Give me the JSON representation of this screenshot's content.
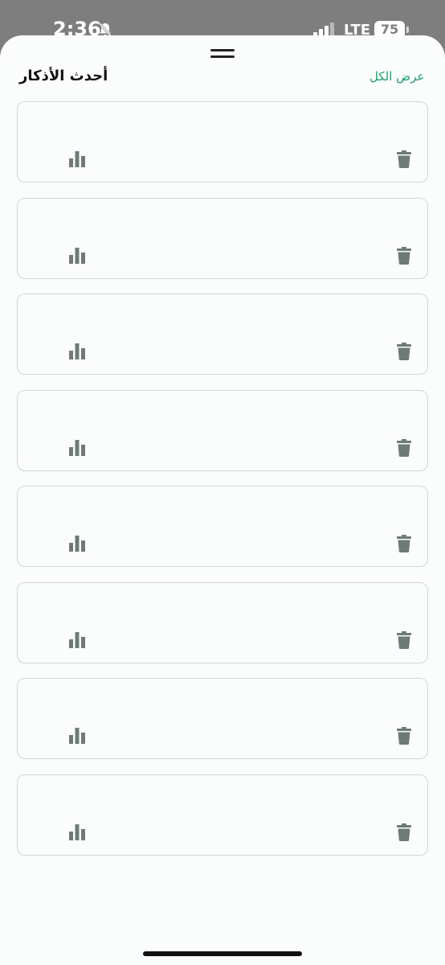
{
  "status_bar": {
    "time": "2:36",
    "network": "LTE",
    "battery": "75"
  },
  "sheet": {
    "title": "أحدث الأذكار",
    "view_all_label": "عرض الكل",
    "accent_color": "#1e9e6a"
  },
  "cards": [
    {
      "stats_icon": "bar-chart-icon",
      "delete_icon": "trash-icon"
    },
    {
      "stats_icon": "bar-chart-icon",
      "delete_icon": "trash-icon"
    },
    {
      "stats_icon": "bar-chart-icon",
      "delete_icon": "trash-icon"
    },
    {
      "stats_icon": "bar-chart-icon",
      "delete_icon": "trash-icon"
    },
    {
      "stats_icon": "bar-chart-icon",
      "delete_icon": "trash-icon"
    },
    {
      "stats_icon": "bar-chart-icon",
      "delete_icon": "trash-icon"
    },
    {
      "stats_icon": "bar-chart-icon",
      "delete_icon": "trash-icon"
    },
    {
      "stats_icon": "bar-chart-icon",
      "delete_icon": "trash-icon"
    }
  ]
}
